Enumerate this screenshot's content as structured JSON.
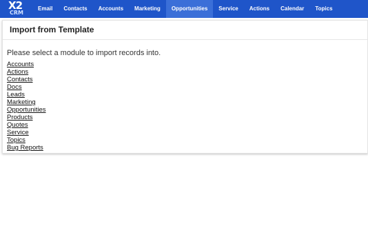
{
  "app": {
    "logo_main": "X2",
    "logo_sub": "CRM"
  },
  "nav": {
    "items": [
      {
        "label": "Email"
      },
      {
        "label": "Contacts"
      },
      {
        "label": "Accounts"
      },
      {
        "label": "Marketing"
      },
      {
        "label": "Opportunities"
      },
      {
        "label": "Service"
      },
      {
        "label": "Actions"
      },
      {
        "label": "Calendar"
      },
      {
        "label": "Topics"
      }
    ],
    "bar_color": "#1f55c9",
    "active_color": "#3b6fd8"
  },
  "main": {
    "title": "Import from Template",
    "instruction": "Please select a module to import records into.",
    "modules": [
      {
        "label": "Accounts"
      },
      {
        "label": "Actions"
      },
      {
        "label": "Contacts"
      },
      {
        "label": "Docs"
      },
      {
        "label": "Leads"
      },
      {
        "label": "Marketing"
      },
      {
        "label": "Opportunities"
      },
      {
        "label": "Products"
      },
      {
        "label": "Quotes"
      },
      {
        "label": "Service"
      },
      {
        "label": "Topics"
      },
      {
        "label": "Bug Reports"
      }
    ]
  }
}
